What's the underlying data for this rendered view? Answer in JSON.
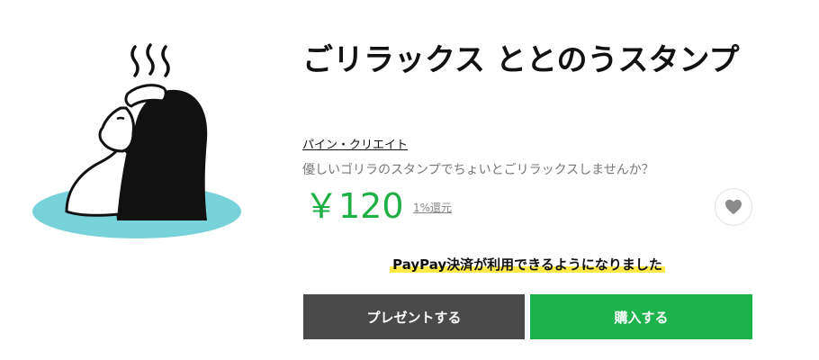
{
  "sticker": {
    "title": "ごリラックス ととのうスタンプ",
    "author": "パイン・クリエイト",
    "description": "優しいゴリラのスタンプでちょいとごリラックスしませんか？",
    "price": "￥120",
    "rebate": "1%還元",
    "thumbnail_icon": "gorilla-onsen-icon"
  },
  "actions": {
    "favorite_icon": "heart-icon",
    "notice": "PayPay決済が利用できるようになりました",
    "present_label": "プレゼントする",
    "buy_label": "購入する"
  },
  "colors": {
    "price": "#1fb045",
    "buy_button": "#1db34c",
    "present_button": "#4a4a4a",
    "highlight": "#ffea4a",
    "water": "#77d3d9"
  }
}
